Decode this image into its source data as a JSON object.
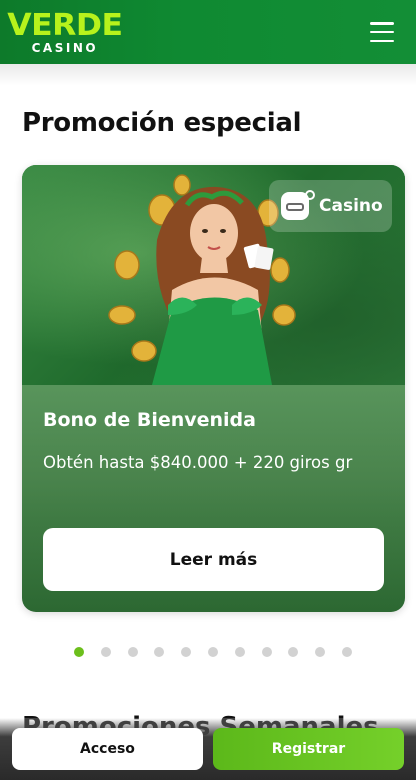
{
  "header": {
    "logo_main": "VERDE",
    "logo_sub": "CASINO",
    "menu_icon": "hamburger-menu-icon"
  },
  "promo": {
    "section_title": "Promoción especial",
    "badge_label": "Casino",
    "badge_icon": "casino-gamepad-icon",
    "title": "Bono de Bienvenida",
    "description": "Obtén hasta $840.000 + 220 giros gr",
    "cta_label": "Leer más",
    "total_slides": 11,
    "active_slide": 1
  },
  "next_section_title": "Promociones Semanales",
  "bottom_bar": {
    "login_label": "Acceso",
    "register_label": "Registrar"
  },
  "colors": {
    "header_green": "#0f8a32",
    "logo_lime": "#b7f21c",
    "accent_green": "#6cbf1c",
    "register_green": "#5cb81a"
  }
}
